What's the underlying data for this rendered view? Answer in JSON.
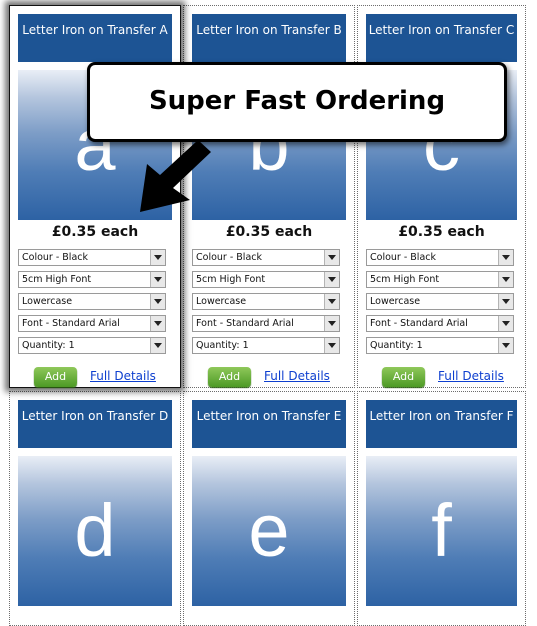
{
  "callout": {
    "text": "Super Fast Ordering"
  },
  "products": [
    {
      "title": "Letter Iron on Transfer A",
      "letter": "a",
      "price": "£0.35 each",
      "options": [
        "Colour - Black",
        "5cm High Font",
        "Lowercase",
        "Font - Standard Arial",
        "Quantity: 1"
      ],
      "add_label": "Add",
      "details_label": "Full Details"
    },
    {
      "title": "Letter Iron on Transfer B",
      "letter": "b",
      "price": "£0.35 each",
      "options": [
        "Colour - Black",
        "5cm High Font",
        "Lowercase",
        "Font - Standard Arial",
        "Quantity: 1"
      ],
      "add_label": "Add",
      "details_label": "Full Details"
    },
    {
      "title": "Letter Iron on Transfer C",
      "letter": "c",
      "price": "£0.35 each",
      "options": [
        "Colour - Black",
        "5cm High Font",
        "Lowercase",
        "Font - Standard Arial",
        "Quantity: 1"
      ],
      "add_label": "Add",
      "details_label": "Full Details"
    },
    {
      "title": "Letter Iron on Transfer D",
      "letter": "d"
    },
    {
      "title": "Letter Iron on Transfer E",
      "letter": "e"
    },
    {
      "title": "Letter Iron on Transfer F",
      "letter": "f"
    }
  ]
}
